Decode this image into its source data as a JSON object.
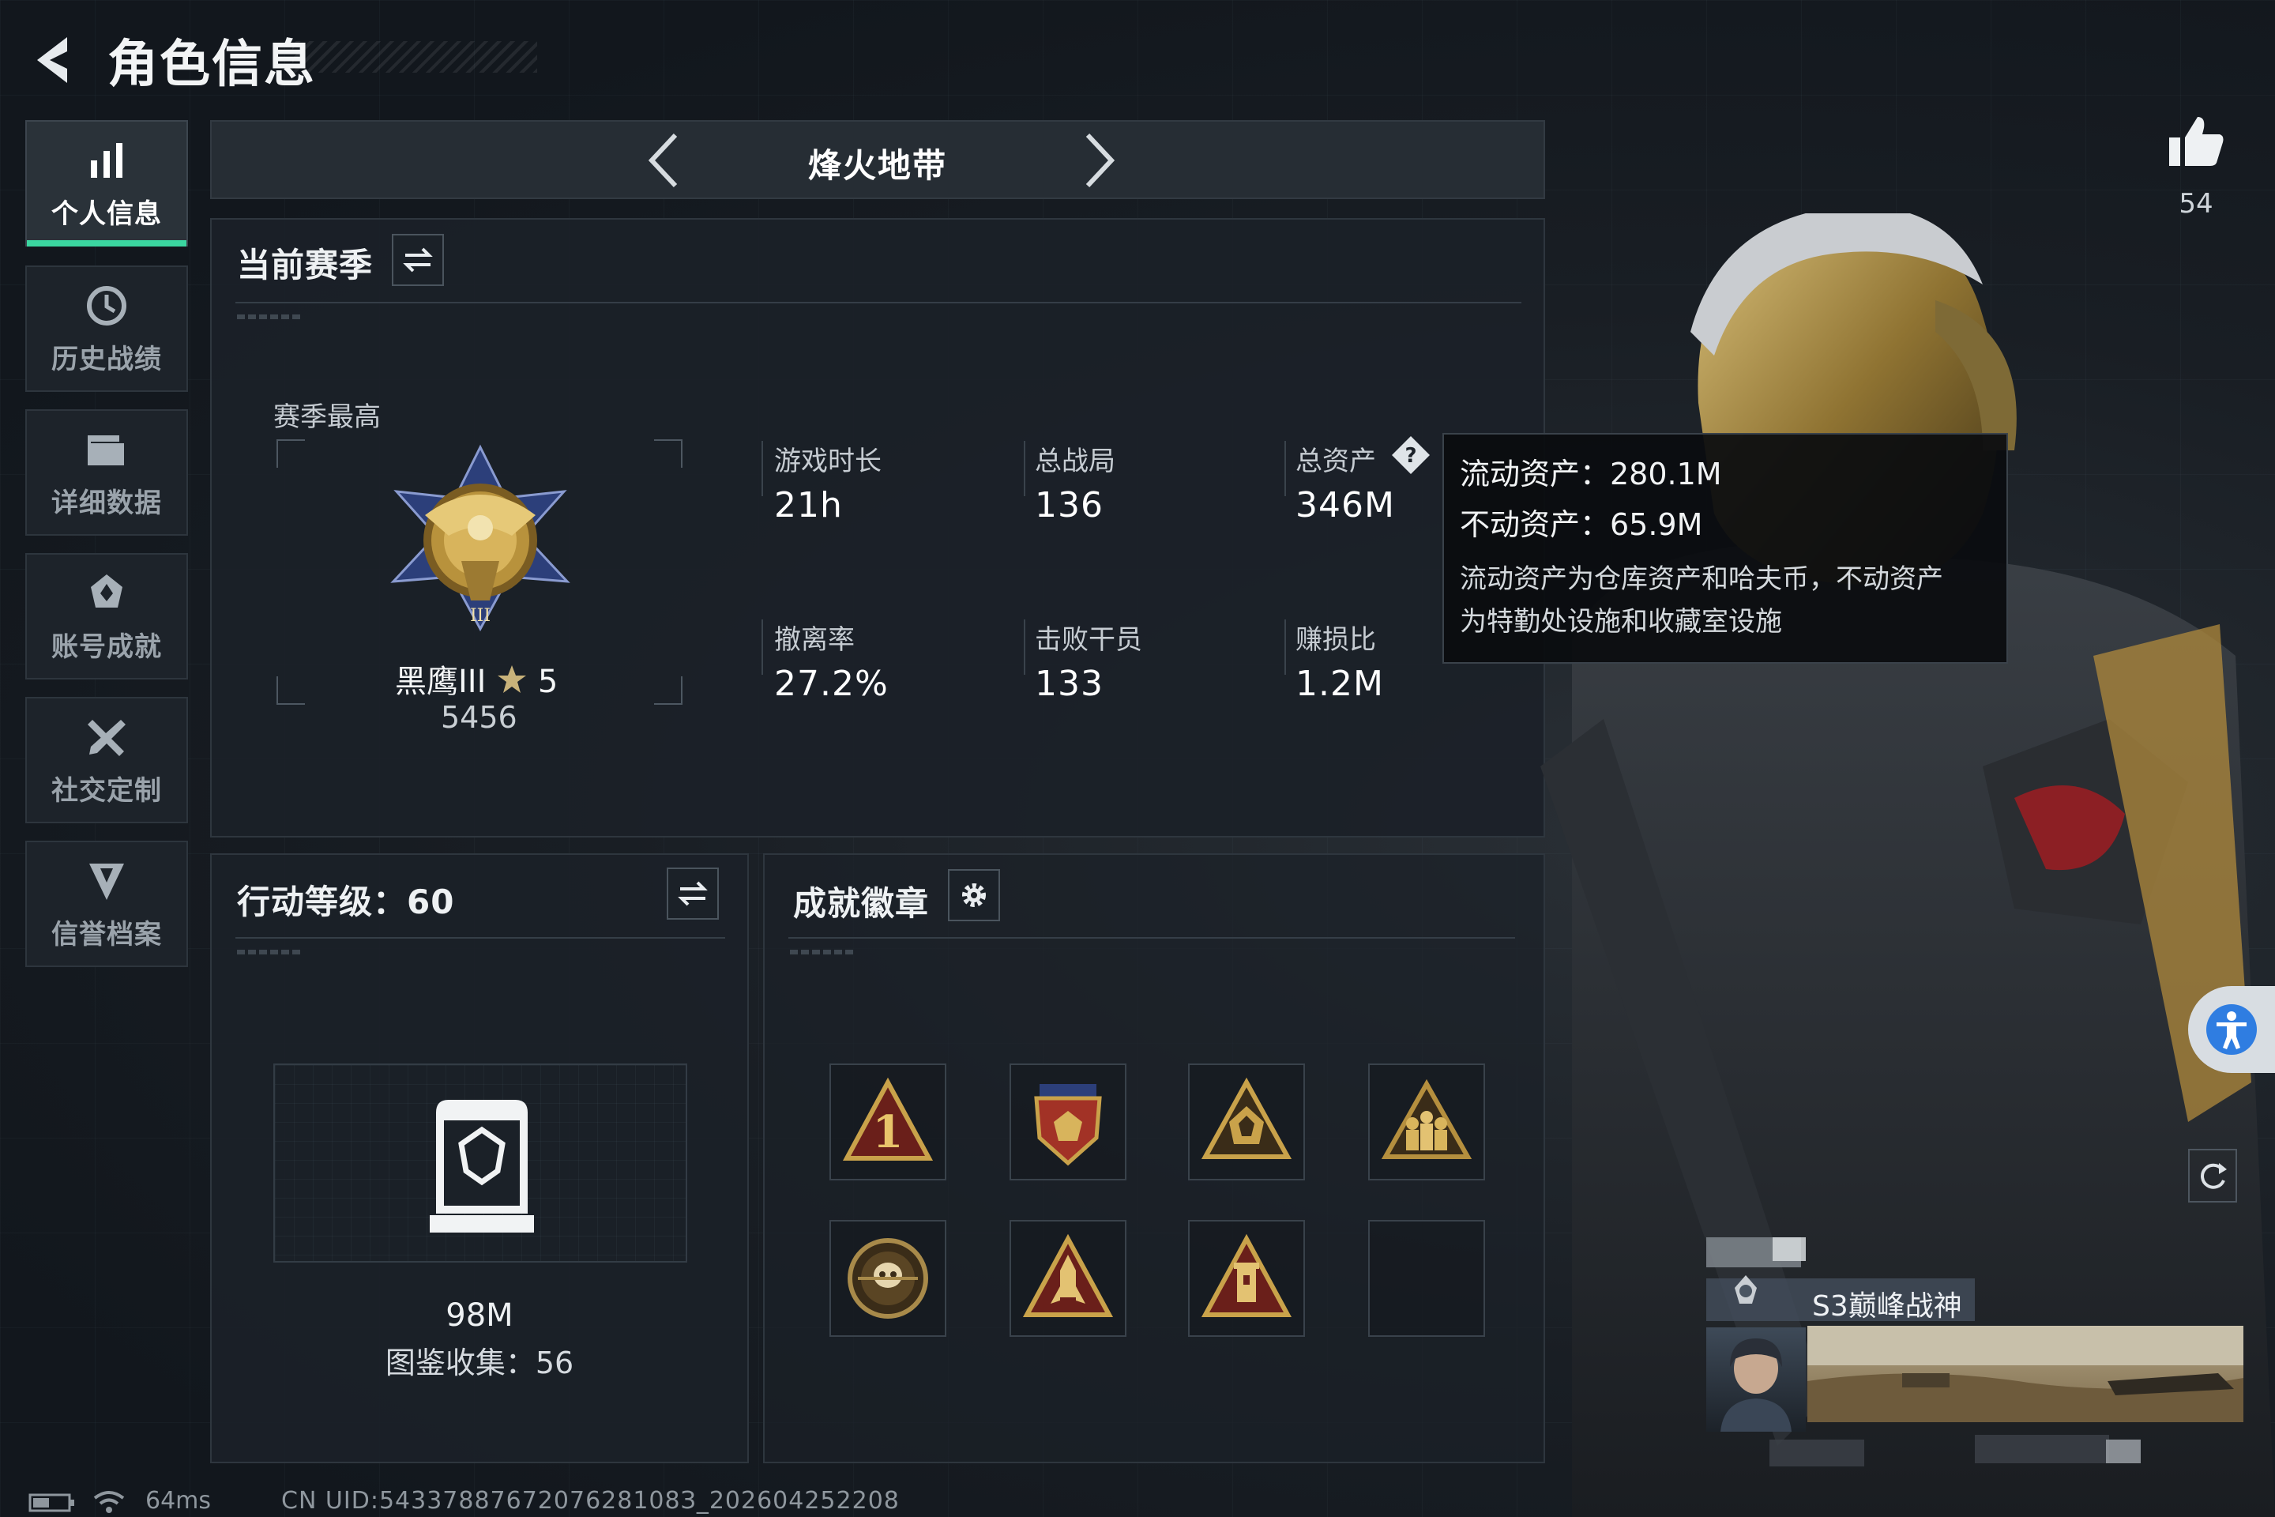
{
  "header": {
    "title": "角色信息"
  },
  "sidebar": {
    "items": [
      {
        "label": "个人信息",
        "icon": "bar-chart-icon",
        "active": true
      },
      {
        "label": "历史战绩",
        "icon": "clock-icon"
      },
      {
        "label": "详细数据",
        "icon": "folder-icon"
      },
      {
        "label": "账号成就",
        "icon": "achievement-icon"
      },
      {
        "label": "社交定制",
        "icon": "tools-icon"
      },
      {
        "label": "信誉档案",
        "icon": "shield-icon"
      }
    ]
  },
  "mode": {
    "name": "烽火地带"
  },
  "season": {
    "title": "当前赛季",
    "best_label": "赛季最高",
    "rank_name": "黑鹰III",
    "rank_stars": "5",
    "rank_points": "5456",
    "stats": [
      {
        "label": "游戏时长",
        "value": "21h"
      },
      {
        "label": "总战局",
        "value": "136"
      },
      {
        "label": "总资产",
        "value": "346M"
      },
      {
        "label": "撤离率",
        "value": "27.2%"
      },
      {
        "label": "击败干员",
        "value": "133"
      },
      {
        "label": "赚损比",
        "value": "1.2M"
      }
    ]
  },
  "tooltip": {
    "line1": "流动资产：280.1M",
    "line2": "不动资产：65.9M",
    "desc_line1": "流动资产为仓库资产和哈夫币，不动资产",
    "desc_line2": "为特勤处设施和收藏室设施"
  },
  "action_level": {
    "title": "行动等级：60",
    "collection_value": "98M",
    "collection_label": "图鉴收集：56"
  },
  "achievements": {
    "title": "成就徽章",
    "badges": [
      {
        "icon": "badge-number-one-icon"
      },
      {
        "icon": "badge-eagle-shield-icon"
      },
      {
        "icon": "badge-triangle-emblem-icon"
      },
      {
        "icon": "badge-soldiers-icon"
      },
      {
        "icon": "badge-skull-round-icon"
      },
      {
        "icon": "badge-rocket-icon"
      },
      {
        "icon": "badge-tower-icon"
      },
      {
        "icon": "empty"
      }
    ]
  },
  "likes": {
    "count": "54"
  },
  "profile": {
    "season_tag": "S3巅峰战神"
  },
  "status": {
    "ping": "64ms",
    "uid": "CN UID:5433788767207628108З_202604252208"
  },
  "colors": {
    "accent": "#3bd6a0",
    "gold": "#c9a24a",
    "panel_bg": "#1b2128"
  }
}
